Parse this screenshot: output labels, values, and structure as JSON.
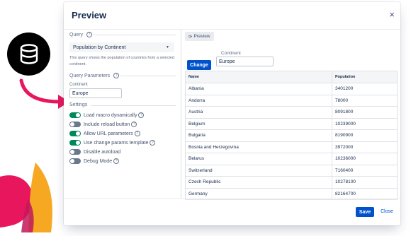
{
  "modal": {
    "title": "Preview",
    "close_icon": "close-icon",
    "close_glyph": "×"
  },
  "query": {
    "legend": "Query",
    "selected": "Population by Continent",
    "description": "This query shows the population of countries from a selected continent."
  },
  "query_parameters": {
    "legend": "Query Parameters",
    "continent_label": "Continent",
    "continent_value": "Europe"
  },
  "settings": {
    "legend": "Settings",
    "toggles": [
      {
        "label": "Load macro dynamically",
        "on": true,
        "help": true
      },
      {
        "label": "Include reload button",
        "on": false,
        "help": true
      },
      {
        "label": "Allow URL parameters",
        "on": true,
        "help": true
      },
      {
        "label": "Use change params template",
        "on": true,
        "help": true
      },
      {
        "label": "Disable autoload",
        "on": false,
        "help": true
      },
      {
        "label": "Debug Mode",
        "on": false,
        "help": true
      }
    ]
  },
  "preview": {
    "tab_label": "Preview",
    "change_button": "Change",
    "continent_label": "Continent",
    "continent_value": "Europe",
    "columns": [
      "Name",
      "Population"
    ],
    "rows": [
      [
        "Albania",
        "3401200"
      ],
      [
        "Andorra",
        "78000"
      ],
      [
        "Austria",
        "8091800"
      ],
      [
        "Belgium",
        "10239000"
      ],
      [
        "Bulgaria",
        "8190900"
      ],
      [
        "Bosnia and Herzegovina",
        "3972000"
      ],
      [
        "Belarus",
        "10236000"
      ],
      [
        "Switzerland",
        "7160400"
      ],
      [
        "Czech Republic",
        "10278100"
      ],
      [
        "Germany",
        "82164700"
      ]
    ]
  },
  "footer": {
    "save_label": "Save",
    "close_label": "Close"
  },
  "colors": {
    "primary": "#0052cc",
    "toggle_on": "#00875a",
    "toggle_off": "#6b778c",
    "arrow": "#e8175d"
  }
}
